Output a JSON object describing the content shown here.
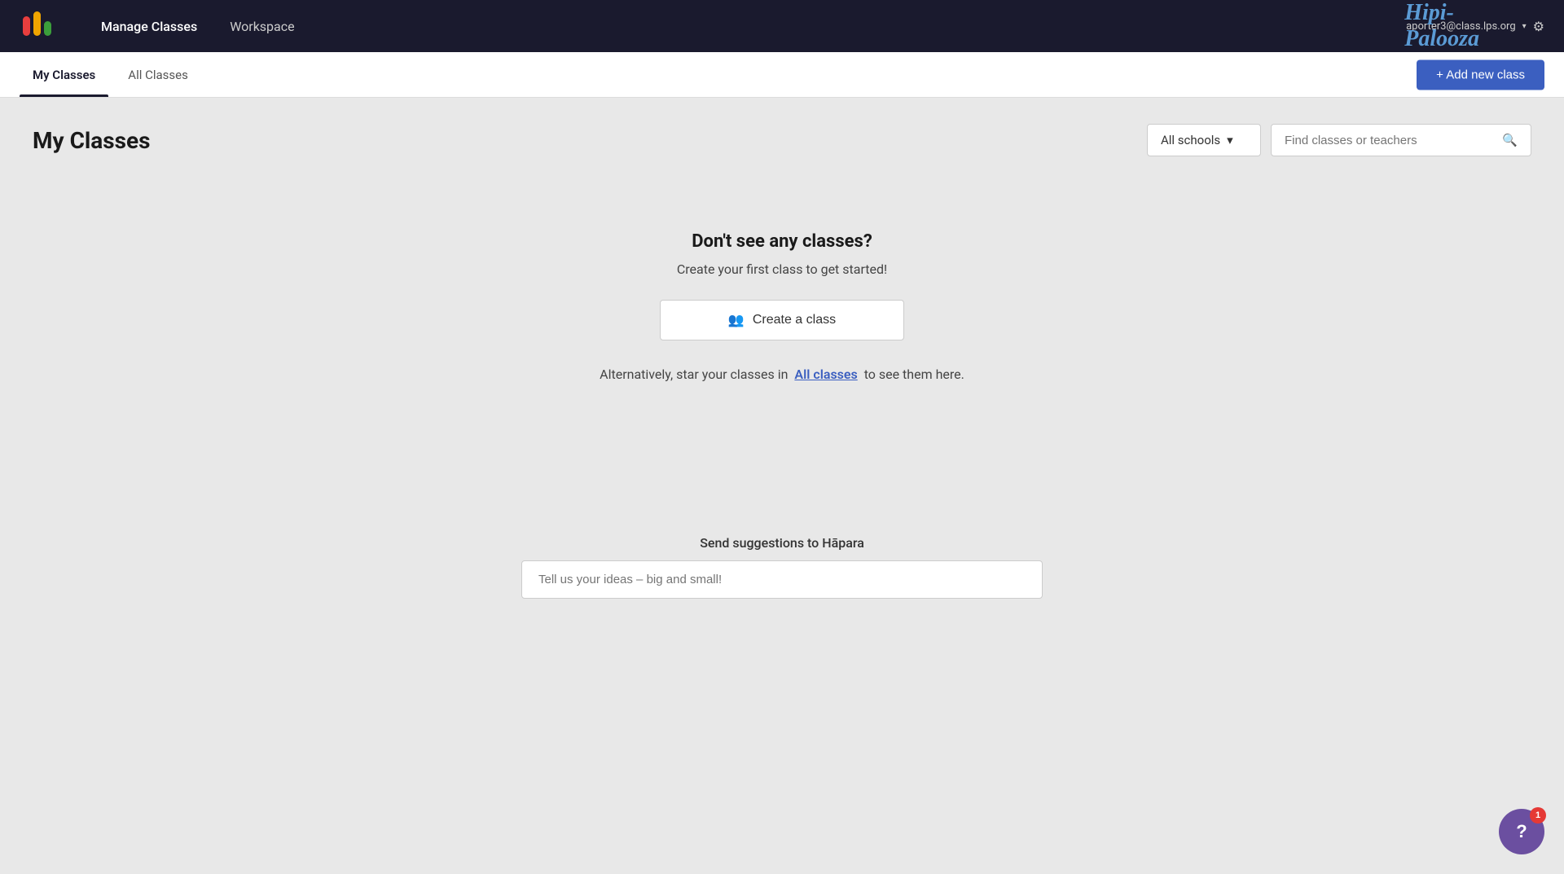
{
  "navbar": {
    "manage_classes_label": "Manage Classes",
    "workspace_label": "Workspace",
    "brand_name": "Hipi-Palooza",
    "user_email": "aporter3@class.lps.org",
    "dropdown_char": "▾"
  },
  "tabs": {
    "my_classes_label": "My Classes",
    "all_classes_label": "All Classes",
    "add_class_label": "+ Add new class"
  },
  "page": {
    "title": "My Classes",
    "schools_dropdown_label": "All schools",
    "search_placeholder": "Find classes or teachers"
  },
  "empty_state": {
    "heading": "Don't see any classes?",
    "subtext": "Create your first class to get started!",
    "create_button_label": "Create a class",
    "alt_text_prefix": "Alternatively, star your classes in",
    "all_classes_link": "All classes",
    "alt_text_suffix": "to see them here."
  },
  "suggestions": {
    "title": "Send suggestions to Hāpara",
    "input_placeholder": "Tell us your ideas – big and small!"
  },
  "help": {
    "badge_count": "1"
  },
  "icons": {
    "search": "🔍",
    "gear": "⚙",
    "group": "👥",
    "question": "?"
  }
}
